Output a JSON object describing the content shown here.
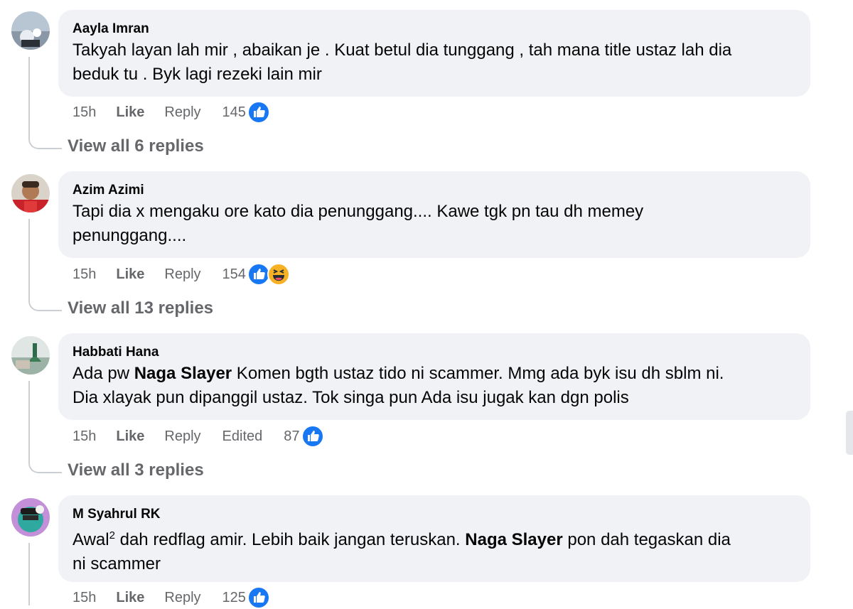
{
  "comments": [
    {
      "author": "Aayla Imran",
      "lines": [
        "Takyah layan lah mir , abaikan je . Kuat betul dia tunggang , tah mana title ustaz lah dia",
        "beduk tu . Byk lagi rezeki lain mir"
      ],
      "time": "15h",
      "like": "Like",
      "reply": "Reply",
      "count": "145",
      "reactions": [
        "like-reaction-icon"
      ],
      "view_replies": "View all 6 replies"
    },
    {
      "author": "Azim Azimi",
      "lines": [
        "Tapi dia x mengaku ore kato dia penunggang.... Kawe tgk pn tau dh memey",
        "penunggang...."
      ],
      "time": "15h",
      "like": "Like",
      "reply": "Reply",
      "count": "154",
      "reactions": [
        "like-reaction-icon",
        "haha-reaction-icon"
      ],
      "view_replies": "View all 13 replies"
    },
    {
      "author": "Habbati Hana",
      "line1_before": "Ada pw ",
      "line1_mention": "Naga Slayer",
      "line1_after": " Komen bgth ustaz tido ni scammer. Mmg ada byk isu dh sblm ni.",
      "line2": "Dia xlayak pun dipanggil ustaz. Tok singa pun Ada isu jugak kan dgn polis",
      "time": "15h",
      "like": "Like",
      "reply": "Reply",
      "edited": "Edited",
      "count": "87",
      "reactions": [
        "like-reaction-icon"
      ],
      "view_replies": "View all 3 replies"
    },
    {
      "author": "M Syahrul RK",
      "line1_before": "Awal",
      "line1_sup": "2",
      "line1_mid": " dah redflag amir. Lebih baik jangan teruskan. ",
      "line1_mention": "Naga Slayer",
      "line1_after": " pon dah tegaskan dia",
      "line2": "ni scammer",
      "time": "15h",
      "like": "Like",
      "reply": "Reply",
      "count": "125",
      "reactions": [
        "like-reaction-icon"
      ]
    }
  ],
  "colors": {
    "bubble": "#f0f2f5",
    "secondary_text": "#65676b",
    "like_blue": "#1877f2",
    "haha_yellow": "#f7b125"
  }
}
